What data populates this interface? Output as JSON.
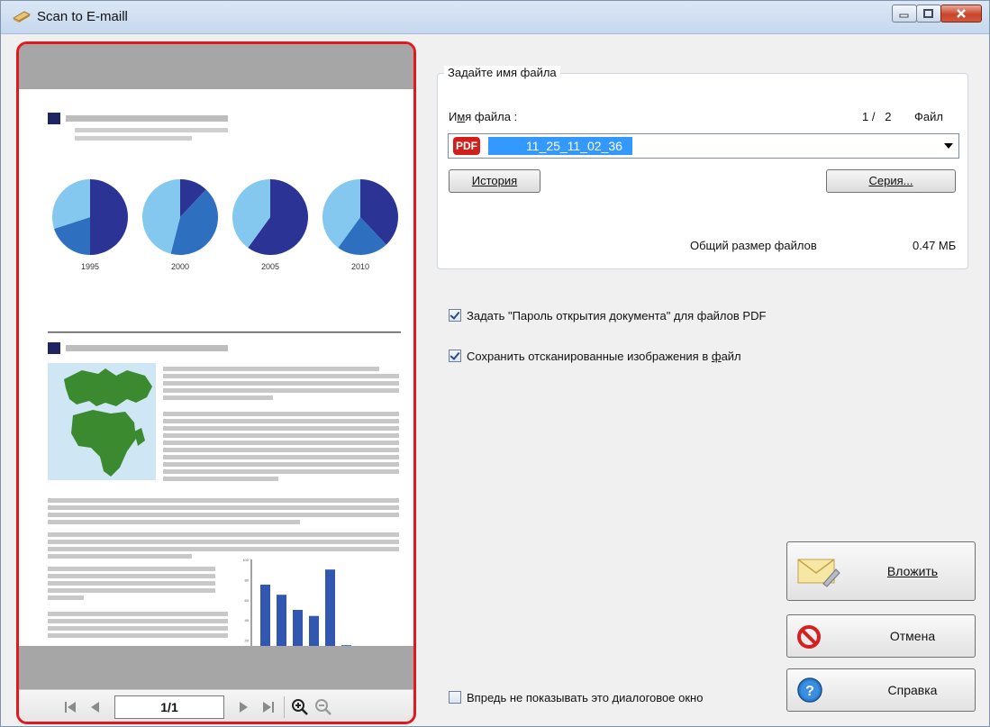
{
  "window": {
    "title": "Scan to E-maill"
  },
  "preview": {
    "page_indicator": "1/1",
    "document": {
      "year_labels": [
        "1995",
        "2000",
        "2005",
        "2010"
      ],
      "bar_axis_ticks": [
        "100",
        "80",
        "60",
        "40",
        "20",
        "0"
      ],
      "bar_values": [
        75,
        65,
        50,
        44,
        90,
        15
      ]
    }
  },
  "filename_group": {
    "legend": "Задайте имя файла",
    "filename_label_pre": "И",
    "filename_label_acc": "м",
    "filename_label_post": "я файла :",
    "file_counter": "1 /   2",
    "file_unit": "Файл",
    "pdf_badge": "PDF",
    "filename_value": "11_25_11_02_36",
    "history_button": "История",
    "series_button": "Серия...",
    "total_size_label": "Общий размер файлов",
    "total_size_value": "0.47 МБ"
  },
  "options": {
    "pdf_password": {
      "checked": true,
      "label": "Задать \"Пароль открытия документа\" для файлов PDF"
    },
    "save_images": {
      "checked": true,
      "label_pre": "Сохранить отсканированные изображения в ",
      "label_acc": "ф",
      "label_post": "айл"
    },
    "dont_show": {
      "checked": false,
      "label": "Впредь не показывать это диалоговое окно"
    }
  },
  "actions": {
    "attach": "Вложить",
    "cancel": "Отмена",
    "help": "Справка"
  },
  "colors": {
    "pie_dark": "#2b3494",
    "pie_mid": "#2f6fc0",
    "pie_light": "#84c8ef",
    "map_green": "#3b8a2f",
    "bar_blue": "#3257b0",
    "preview_border": "#e0191f",
    "selection_blue": "#3399ff"
  },
  "icons": [
    "scanner-icon",
    "minimize-icon",
    "maximize-icon",
    "close-icon",
    "first-page-icon",
    "prev-page-icon",
    "next-page-icon",
    "last-page-icon",
    "zoom-in-icon",
    "zoom-out-icon",
    "envelope-icon",
    "prohibit-icon",
    "help-icon"
  ]
}
